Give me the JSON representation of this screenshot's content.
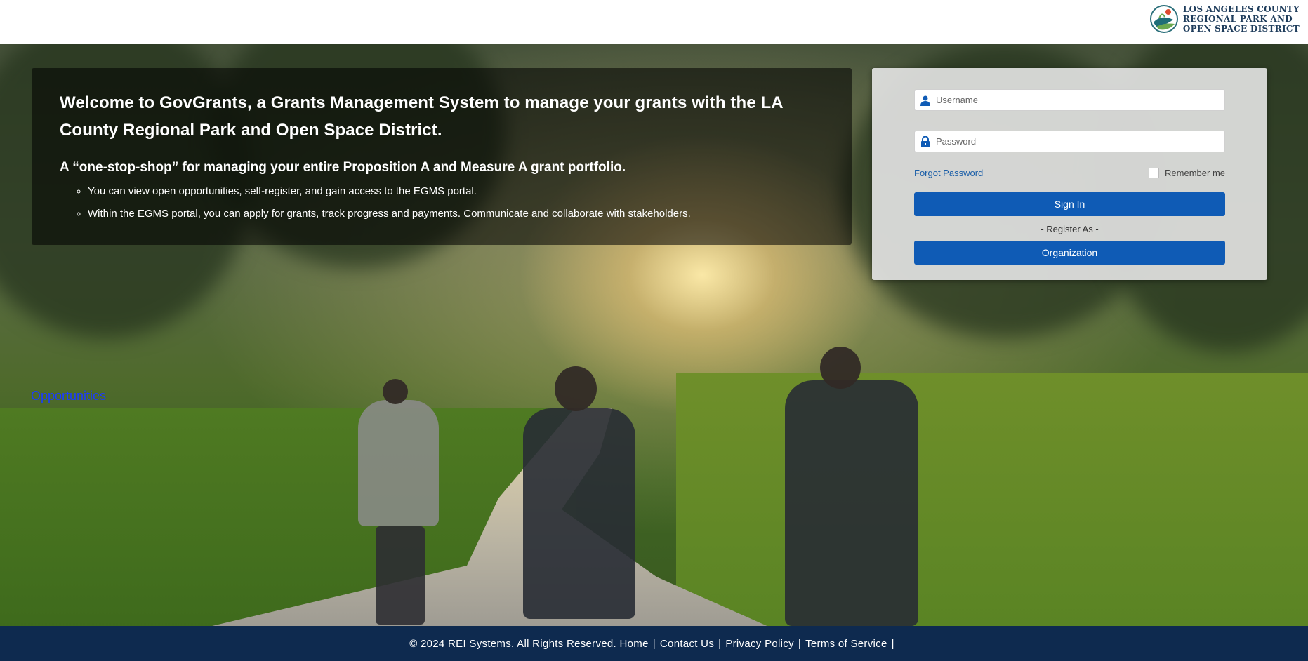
{
  "header": {
    "logo_lines": [
      "LOS ANGELES COUNTY",
      "REGIONAL PARK AND",
      "OPEN SPACE DISTRICT"
    ]
  },
  "welcome": {
    "title": "Welcome to GovGrants, a Grants Management System to manage your grants with the LA County Regional Park and Open Space District.",
    "subtitle": "A “one-stop-shop” for managing your entire Proposition A and Measure A grant portfolio.",
    "bullets": [
      "You can view open opportunities, self-register, and gain access to the EGMS portal.",
      "Within the EGMS portal, you can apply for grants, track progress and payments. Communicate and collaborate with stakeholders."
    ]
  },
  "login": {
    "username_placeholder": "Username",
    "password_placeholder": "Password",
    "forgot_password": "Forgot Password",
    "remember_me": "Remember me",
    "remember_checked": false,
    "sign_in": "Sign In",
    "register_as": "- Register As -",
    "organization": "Organization"
  },
  "opportunities_link": "Opportunities",
  "footer": {
    "copyright": "© 2024 REI Systems. All Rights Reserved.",
    "links": [
      "Home",
      "Contact Us",
      "Privacy Policy",
      "Terms of Service"
    ],
    "separator": "|"
  },
  "colors": {
    "primary_button": "#0f5bb5",
    "footer_bg": "#0e2a4f",
    "link": "#1a5ea8",
    "opportunities_link": "#1a3cff"
  },
  "icons": {
    "username": "user-icon",
    "password": "lock-icon"
  }
}
